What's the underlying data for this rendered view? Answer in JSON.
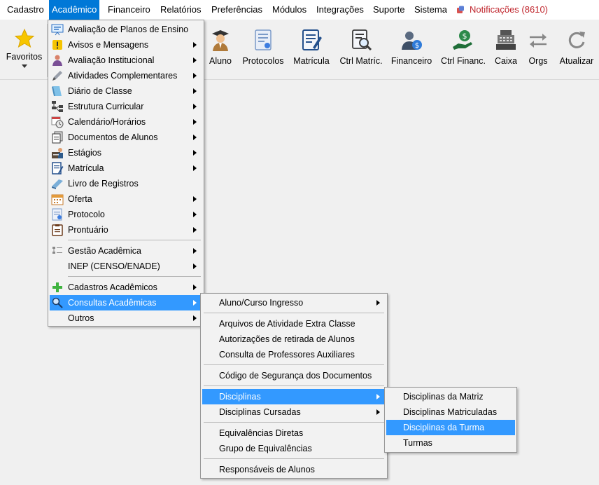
{
  "menubar": {
    "items": [
      {
        "label": "Cadastro",
        "active": false
      },
      {
        "label": "Acadêmico",
        "active": true
      },
      {
        "label": "Financeiro",
        "active": false
      },
      {
        "label": "Relatórios",
        "active": false
      },
      {
        "label": "Preferências",
        "active": false
      },
      {
        "label": "Módulos",
        "active": false
      },
      {
        "label": "Integrações",
        "active": false
      },
      {
        "label": "Suporte",
        "active": false
      },
      {
        "label": "Sistema",
        "active": false
      }
    ],
    "notifications": "Notificações (8610)"
  },
  "toolbar": {
    "favorites": "Favoritos",
    "buttons": [
      {
        "label": "Aluno",
        "icon": "student-icon"
      },
      {
        "label": "Protocolos",
        "icon": "protocols-icon"
      },
      {
        "label": "Matrícula",
        "icon": "enrollment-icon"
      },
      {
        "label": "Ctrl Matríc.",
        "icon": "enrollment-control-icon"
      },
      {
        "label": "Financeiro",
        "icon": "finance-icon"
      },
      {
        "label": "Ctrl Financ.",
        "icon": "finance-control-icon"
      },
      {
        "label": "Caixa",
        "icon": "cash-register-icon"
      },
      {
        "label": "Orgs",
        "icon": "swap-arrows-icon"
      },
      {
        "label": "Atualizar",
        "icon": "refresh-icon"
      }
    ]
  },
  "academic_menu": {
    "items": [
      {
        "label": "Avaliação de Planos de Ensino",
        "submenu": false,
        "icon": "teaching-plan-icon"
      },
      {
        "label": "Avisos e Mensagens",
        "submenu": true,
        "icon": "warning-icon"
      },
      {
        "label": "Avaliação Institucional",
        "submenu": true,
        "icon": "institutional-evaluation-icon"
      },
      {
        "label": "Atividades Complementares",
        "submenu": true,
        "icon": "pencil-icon"
      },
      {
        "label": "Diário de Classe",
        "submenu": true,
        "icon": "class-diary-icon"
      },
      {
        "label": "Estrutura Curricular",
        "submenu": true,
        "icon": "hierarchy-icon"
      },
      {
        "label": "Calendário/Horários",
        "submenu": true,
        "icon": "calendar-clock-icon"
      },
      {
        "label": "Documentos de Alunos",
        "submenu": true,
        "icon": "documents-icon"
      },
      {
        "label": "Estágios",
        "submenu": true,
        "icon": "internship-icon"
      },
      {
        "label": "Matrícula",
        "submenu": true,
        "icon": "enrollment-form-icon"
      },
      {
        "label": "Livro de Registros",
        "submenu": false,
        "icon": "book-icon"
      },
      {
        "label": "Oferta",
        "submenu": true,
        "icon": "calendar-icon"
      },
      {
        "label": "Protocolo",
        "submenu": true,
        "icon": "protocol-icon"
      },
      {
        "label": "Prontuário",
        "submenu": true,
        "icon": "clipboard-icon"
      },
      {
        "label": "Gestão Acadêmica",
        "submenu": true,
        "icon": "management-icon"
      },
      {
        "label": "INEP (CENSO/ENADE)",
        "submenu": true,
        "icon": ""
      },
      {
        "label": "Cadastros Acadêmicos",
        "submenu": true,
        "icon": "plus-icon"
      },
      {
        "label": "Consultas Acadêmicas",
        "submenu": true,
        "icon": "magnifier-icon"
      },
      {
        "label": "Outros",
        "submenu": true,
        "icon": ""
      }
    ]
  },
  "consultas_menu": {
    "items": [
      {
        "label": "Aluno/Curso Ingresso",
        "submenu": true
      },
      {
        "label": "Arquivos de Atividade Extra Classe",
        "submenu": false
      },
      {
        "label": "Autorizações de retirada de Alunos",
        "submenu": false
      },
      {
        "label": "Consulta de Professores Auxiliares",
        "submenu": false
      },
      {
        "label": "Código de Segurança dos Documentos",
        "submenu": false
      },
      {
        "label": "Disciplinas",
        "submenu": true
      },
      {
        "label": "Disciplinas Cursadas",
        "submenu": true
      },
      {
        "label": "Equivalências Diretas",
        "submenu": false
      },
      {
        "label": "Grupo de Equivalências",
        "submenu": false
      },
      {
        "label": "Responsáveis de Alunos",
        "submenu": false
      }
    ]
  },
  "disciplinas_menu": {
    "items": [
      {
        "label": "Disciplinas da Matriz"
      },
      {
        "label": "Disciplinas Matriculadas"
      },
      {
        "label": "Disciplinas da Turma"
      },
      {
        "label": "Turmas"
      }
    ]
  },
  "colors": {
    "highlight": "#3399ff",
    "menubar_active": "#0078d7",
    "notification": "#c0262d"
  }
}
